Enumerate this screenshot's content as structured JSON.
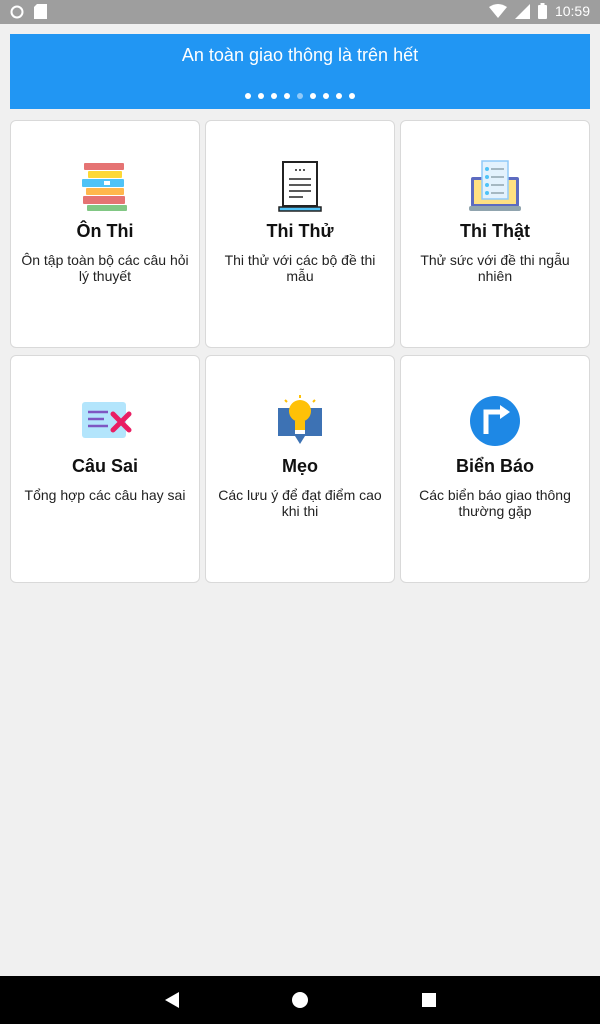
{
  "status_bar": {
    "time": "10:59",
    "icons": [
      "circle-status-icon",
      "sd-card-icon",
      "wifi-icon",
      "signal-icon",
      "battery-icon"
    ]
  },
  "banner": {
    "title": "An toàn giao thông là trên hết",
    "dot_count": 9,
    "active_dot": 4,
    "color": "#2196f3"
  },
  "cards": [
    {
      "title": "Ôn Thi",
      "desc": "Ôn tập toàn bộ các câu hỏi lý thuyết",
      "icon": "books-icon"
    },
    {
      "title": "Thi Thử",
      "desc": "Thi thử với các bộ đề thi mẫu",
      "icon": "document-icon"
    },
    {
      "title": "Thi Thật",
      "desc": "Thử sức với đề thi ngẫu nhiên",
      "icon": "checklist-laptop-icon"
    },
    {
      "title": "Câu Sai",
      "desc": "Tổng hợp các câu hay sai",
      "icon": "wrong-note-icon"
    },
    {
      "title": "Mẹo",
      "desc": "Các lưu ý để đạt điểm cao khi thi",
      "icon": "lightbulb-icon"
    },
    {
      "title": "Biển Báo",
      "desc": "Các biển báo giao thông thường gặp",
      "icon": "traffic-sign-icon"
    }
  ],
  "nav": {
    "back": "back-icon",
    "home": "home-icon",
    "recents": "recents-icon"
  }
}
